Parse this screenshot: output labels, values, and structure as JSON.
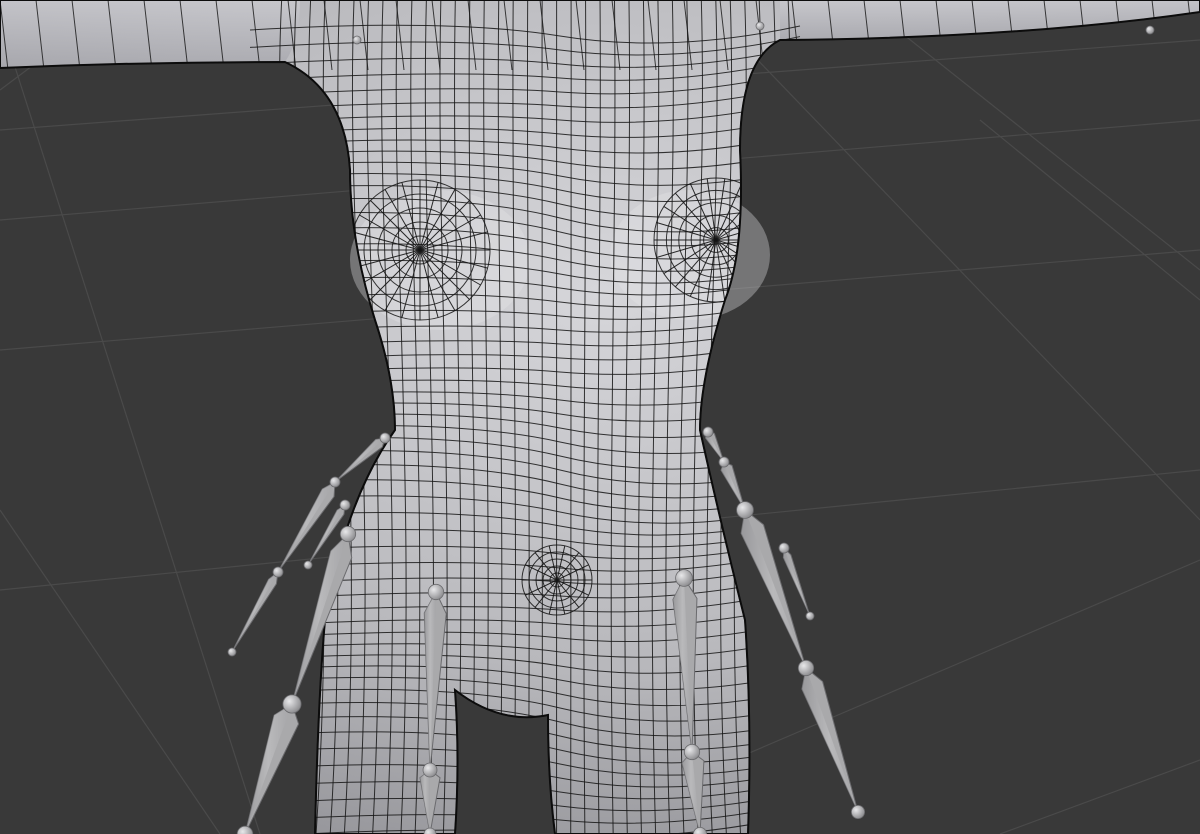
{
  "viewport": {
    "background_color": "#393939",
    "grid_color": "#4a4a4a",
    "mesh_color": "#b6b6b9",
    "mesh_highlight_color": "#dcdcdf",
    "wire_color": "#151515",
    "bone_color": "#a9a9ab",
    "mode": "wireframe-overlay",
    "objects": [
      {
        "name": "body-mesh",
        "kind": "mesh"
      },
      {
        "name": "armature",
        "kind": "armature"
      }
    ]
  }
}
